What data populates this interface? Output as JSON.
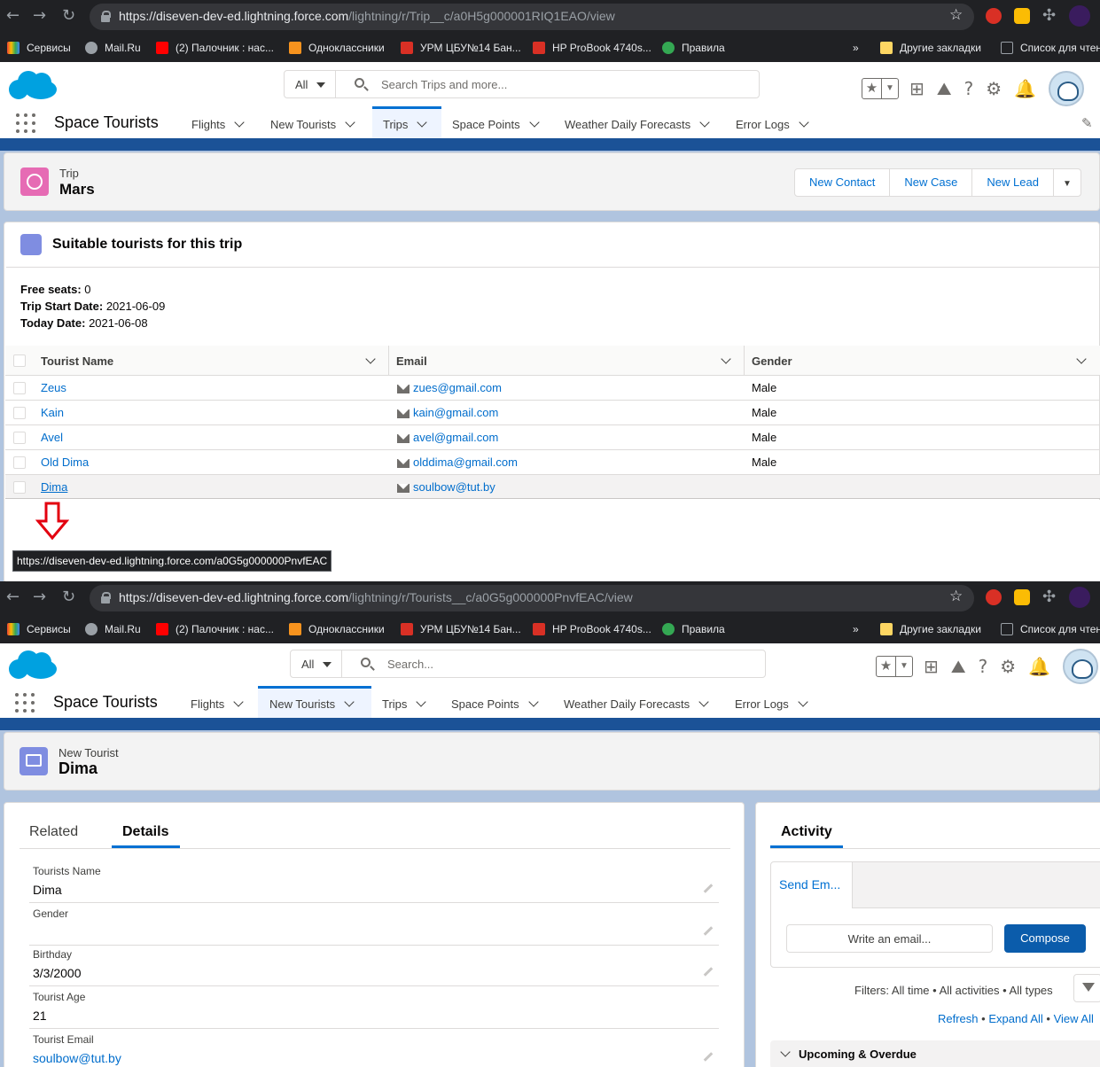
{
  "top": {
    "browser": {
      "url_host": "https://diseven-dev-ed.lightning.force.com",
      "url_path": "/lightning/r/Trip__c/a0H5g000001RIQ1EAO/view"
    },
    "bookmarks": [
      "Сервисы",
      "Mail.Ru",
      "(2) Палочник : нас...",
      "Одноклассники",
      "УРМ ЦБУ№14 Бан...",
      "HP ProBook 4740s...",
      "Правила"
    ],
    "bookmarks_right": [
      "Другие закладки",
      "Список для чтен"
    ],
    "search": {
      "scope": "All",
      "placeholder": "Search Trips and more..."
    },
    "app_name": "Space Tourists",
    "nav": [
      "Flights",
      "New Tourists",
      "Trips",
      "Space Points",
      "Weather Daily Forecasts",
      "Error Logs"
    ],
    "active_nav": "Trips",
    "record": {
      "type": "Trip",
      "name": "Mars"
    },
    "actions": [
      "New Contact",
      "New Case",
      "New Lead"
    ],
    "component_title": "Suitable tourists for this trip",
    "info": {
      "free_seats_label": "Free seats:",
      "free_seats": "0",
      "start_label": "Trip Start Date:",
      "start": "2021-06-09",
      "today_label": "Today Date:",
      "today": "2021-06-08"
    },
    "columns": [
      "Tourist Name",
      "Email",
      "Gender"
    ],
    "rows": [
      {
        "name": "Zeus",
        "email": "zues@gmail.com",
        "gender": "Male"
      },
      {
        "name": "Kain",
        "email": "kain@gmail.com",
        "gender": "Male"
      },
      {
        "name": "Avel",
        "email": "avel@gmail.com",
        "gender": "Male"
      },
      {
        "name": "Old Dima",
        "email": "olddima@gmail.com",
        "gender": "Male"
      },
      {
        "name": "Dima",
        "email": "soulbow@tut.by",
        "gender": ""
      }
    ],
    "tooltip": "https://diseven-dev-ed.lightning.force.com/a0G5g000000PnvfEAC"
  },
  "bottom": {
    "browser": {
      "url_host": "https://diseven-dev-ed.lightning.force.com",
      "url_path": "/lightning/r/Tourists__c/a0G5g000000PnvfEAC/view"
    },
    "search": {
      "scope": "All",
      "placeholder": "Search..."
    },
    "active_nav": "New Tourists",
    "record": {
      "type": "New Tourist",
      "name": "Dima"
    },
    "tabs": [
      "Related",
      "Details"
    ],
    "fields": [
      {
        "label": "Tourists Name",
        "value": "Dima"
      },
      {
        "label": "Gender",
        "value": ""
      },
      {
        "label": "Birthday",
        "value": "3/3/2000"
      },
      {
        "label": "Tourist Age",
        "value": "21"
      },
      {
        "label": "Tourist Email",
        "value": "soulbow@tut.by"
      }
    ],
    "activity": {
      "title": "Activity",
      "send_tab": "Send Em...",
      "email_placeholder": "Write an email...",
      "compose": "Compose",
      "filters": "Filters: All time • All activities • All types",
      "links": [
        "Refresh",
        "Expand All",
        "View All"
      ],
      "section": "Upcoming & Overdue"
    }
  },
  "colors": {
    "brand": "#00a1e0",
    "link": "#006dcc",
    "nav_active": "#0070d2",
    "header_band": "#1b5297"
  }
}
